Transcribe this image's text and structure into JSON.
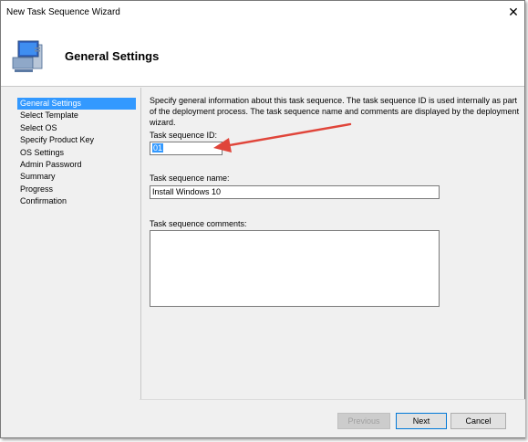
{
  "window": {
    "title": "New Task Sequence Wizard",
    "close_glyph": "✕"
  },
  "header": {
    "title": "General Settings",
    "icon": "computer-icon"
  },
  "nav": {
    "items": [
      {
        "label": "General Settings",
        "active": true
      },
      {
        "label": "Select Template"
      },
      {
        "label": "Select OS"
      },
      {
        "label": "Specify Product Key"
      },
      {
        "label": "OS Settings"
      },
      {
        "label": "Admin Password"
      },
      {
        "label": "Summary"
      },
      {
        "label": "Progress"
      },
      {
        "label": "Confirmation"
      }
    ]
  },
  "content": {
    "description": "Specify general information about this task sequence.  The task sequence ID is used internally as part of the deployment process.  The task sequence name and comments are displayed by the deployment wizard.",
    "id_label": "Task sequence ID:",
    "id_value": "01",
    "name_label": "Task sequence name:",
    "name_value": "Install Windows 10",
    "comments_label": "Task sequence comments:",
    "comments_value": ""
  },
  "buttons": {
    "previous": "Previous",
    "next": "Next",
    "cancel": "Cancel"
  },
  "colors": {
    "selection": "#3399ff",
    "annotation_arrow": "#e0453a"
  }
}
